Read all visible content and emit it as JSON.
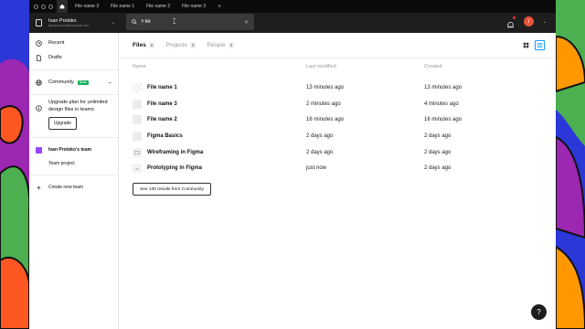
{
  "window": {
    "tabs": [
      "File name 3",
      "File name 1",
      "File name 2",
      "File name 3"
    ],
    "new_tab": "+"
  },
  "account": {
    "name": "Ivan Protsko",
    "email": "figmacurious@example.com"
  },
  "search": {
    "value": "File",
    "placeholder": "Search"
  },
  "user": {
    "avatar_letter": "I"
  },
  "sidebar": {
    "recent": "Recent",
    "drafts": "Drafts",
    "community": "Community",
    "community_badge": "Beta",
    "upgrade_text": "Upgrade plan for unlimited design files in teams",
    "upgrade_button": "Upgrade",
    "team_name": "Ivan Protsko's team",
    "team_project": "Team project",
    "create_team": "Create new team"
  },
  "filters": {
    "tabs": [
      {
        "label": "Files",
        "count": "6"
      },
      {
        "label": "Projects",
        "count": "0"
      },
      {
        "label": "People",
        "count": "0"
      }
    ]
  },
  "table": {
    "headers": {
      "name": "Name",
      "modified": "Last modified",
      "created": "Created"
    },
    "rows": [
      {
        "name": "File name 1",
        "modified": "13 minutes ago",
        "created": "13 minutes ago"
      },
      {
        "name": "File name 3",
        "modified": "2 minutes ago",
        "created": "4 minutes ago"
      },
      {
        "name": "File name 2",
        "modified": "16 minutes ago",
        "created": "16 minutes ago"
      },
      {
        "name": "Figma Basics",
        "modified": "2 days ago",
        "created": "2 days ago"
      },
      {
        "name": "Wireframing in Figma",
        "modified": "2 days ago",
        "created": "2 days ago"
      },
      {
        "name": "Prototyping in Figma",
        "modified": "just now",
        "created": "2 days ago"
      }
    ]
  },
  "see_more_button": "See 100 results from Community",
  "help_button": "?",
  "colors": {
    "background": "#2b37d6",
    "topbar": "#1e1e1e",
    "accent": "#18a0fb",
    "beta_badge": "#14ae5c",
    "team": "#9747ff",
    "avatar": "#e8553c"
  }
}
